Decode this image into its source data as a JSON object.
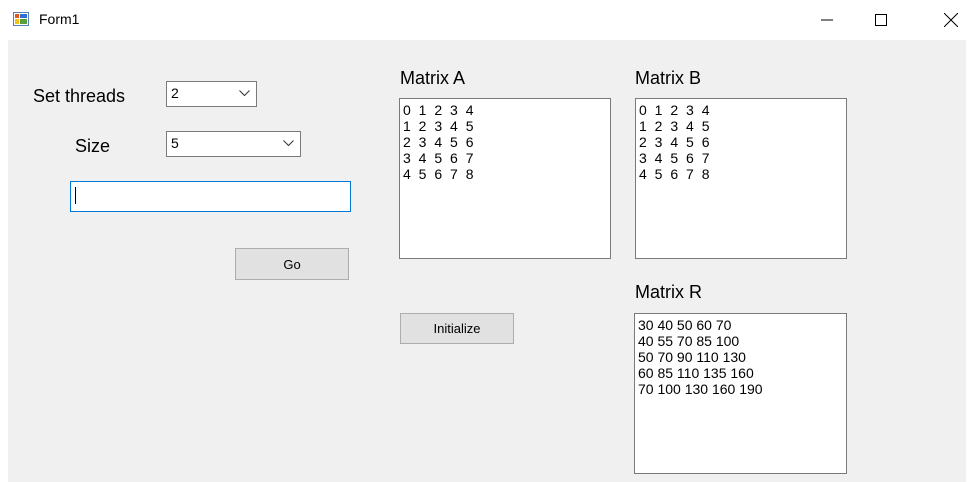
{
  "window": {
    "title": "Form1"
  },
  "labels": {
    "set_threads": "Set threads",
    "size": "Size",
    "matrix_a": "Matrix A",
    "matrix_b": "Matrix B",
    "matrix_r": "Matrix R"
  },
  "controls": {
    "threads_value": "2",
    "size_value": "5",
    "text_input_value": "",
    "go_label": "Go",
    "initialize_label": "Initialize"
  },
  "matrix_a": {
    "lines": [
      "0 1 2 3 4",
      "1 2 3 4 5",
      "2 3 4 5 6",
      "3 4 5 6 7",
      "4 5 6 7 8"
    ]
  },
  "matrix_b": {
    "lines": [
      "0 1 2 3 4",
      "1 2 3 4 5",
      "2 3 4 5 6",
      "3 4 5 6 7",
      "4 5 6 7 8"
    ]
  },
  "matrix_r": {
    "lines": [
      "30 40 50 60 70",
      "40 55 70 85 100",
      "50 70 90 110 130",
      "60 85 110 135 160",
      "70 100 130 160 190"
    ]
  },
  "icons": [
    "app-icon",
    "minimize-icon",
    "maximize-icon",
    "close-icon",
    "chevron-down-icon"
  ]
}
